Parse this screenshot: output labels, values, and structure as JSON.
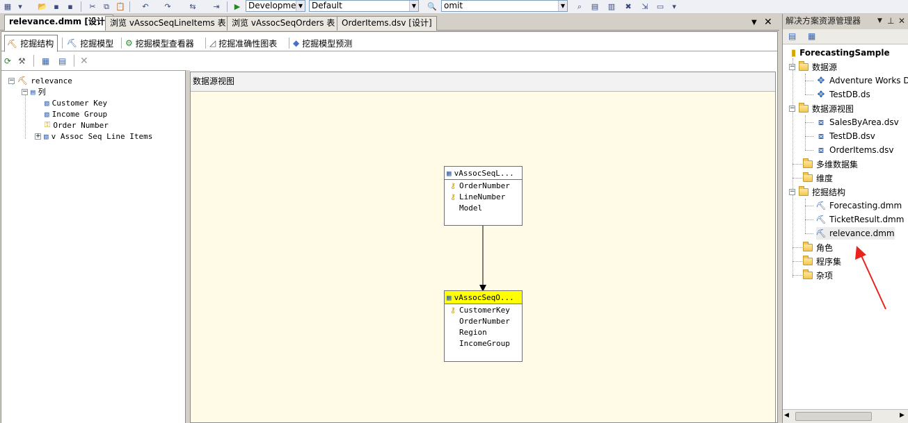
{
  "toolbar": {
    "config_combo": "Development",
    "platform_combo": "Default",
    "find_combo": "omit"
  },
  "doc_tabs": [
    {
      "label": "relevance.dmm [设计]",
      "active": true
    },
    {
      "label": "浏览 vAssocSeqLineItems 表",
      "active": false
    },
    {
      "label": "浏览 vAssocSeqOrders 表",
      "active": false
    },
    {
      "label": "OrderItems.dsv [设计]",
      "active": false
    }
  ],
  "designer_tabs": [
    {
      "label": "挖掘结构",
      "icon": "mining-structure-icon"
    },
    {
      "label": "挖掘模型",
      "icon": "mining-model-icon"
    },
    {
      "label": "挖掘模型查看器",
      "icon": "model-viewer-icon"
    },
    {
      "label": "挖掘准确性图表",
      "icon": "accuracy-chart-icon"
    },
    {
      "label": "挖掘模型预测",
      "icon": "prediction-icon"
    }
  ],
  "structure_tree": {
    "root": "relevance",
    "columns_label": "列",
    "items": [
      "Customer Key",
      "Income Group",
      "Order Number",
      "v Assoc Seq Line Items"
    ]
  },
  "dsv": {
    "header": "数据源视图",
    "tables": [
      {
        "title": "vAssocSeqL...",
        "rows": [
          "OrderNumber",
          "LineNumber",
          "Model"
        ],
        "keys": [
          true,
          true,
          false
        ],
        "selected": false
      },
      {
        "title": "vAssocSeqO...",
        "rows": [
          "CustomerKey",
          "OrderNumber",
          "Region",
          "IncomeGroup"
        ],
        "keys": [
          true,
          false,
          false,
          false
        ],
        "selected": true
      }
    ]
  },
  "solution": {
    "title": "解决方案资源管理器",
    "project": "ForecastingSample",
    "nodes": [
      {
        "label": "数据源",
        "children": [
          "Adventure Works D",
          "TestDB.ds"
        ]
      },
      {
        "label": "数据源视图",
        "children": [
          "SalesByArea.dsv",
          "TestDB.dsv",
          "OrderItems.dsv"
        ]
      },
      {
        "label": "多维数据集",
        "children": []
      },
      {
        "label": "维度",
        "children": []
      },
      {
        "label": "挖掘结构",
        "children": [
          "Forecasting.dmm",
          "TicketResult.dmm",
          "relevance.dmm"
        ]
      },
      {
        "label": "角色",
        "children": []
      },
      {
        "label": "程序集",
        "children": []
      },
      {
        "label": "杂项",
        "children": []
      }
    ]
  },
  "colors": {
    "selected_table_header": "#ffff00",
    "dsv_background": "#fffbe6",
    "annotation_arrow": "#e8231d"
  }
}
